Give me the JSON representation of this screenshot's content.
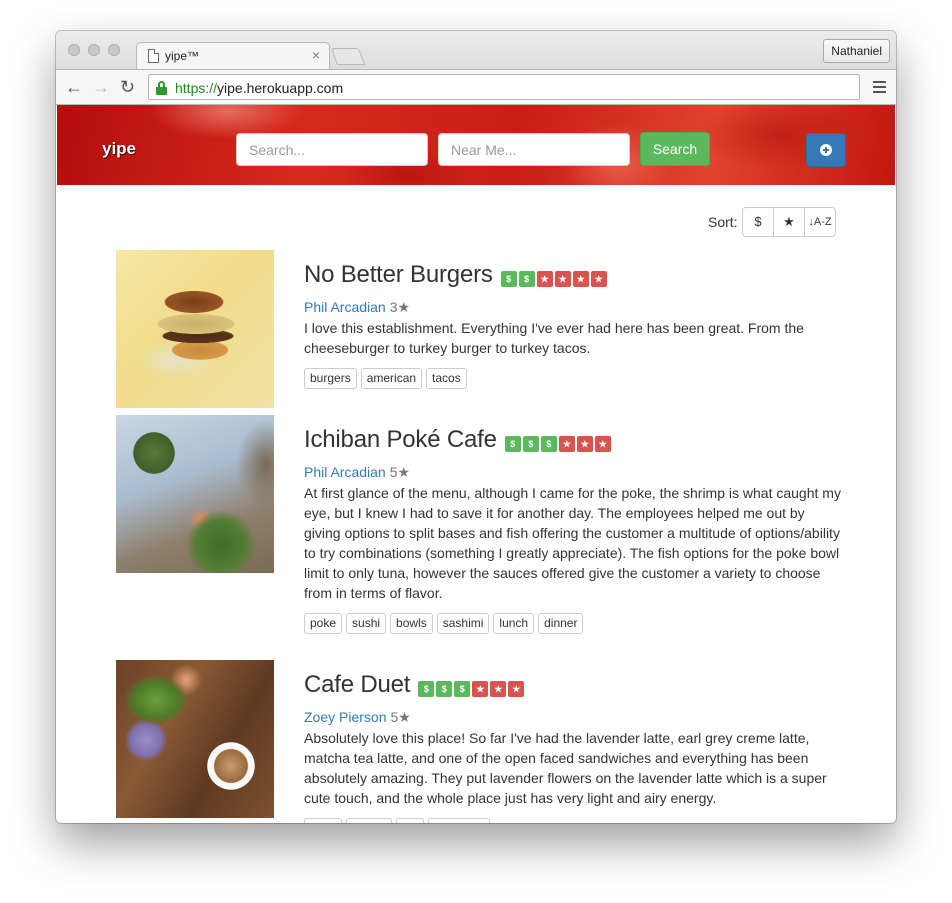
{
  "browser": {
    "tab_title": "yipe™",
    "tab_close": "×",
    "profile": "Nathaniel",
    "url_scheme": "https://",
    "url_host": "yipe.herokuapp.com"
  },
  "header": {
    "brand": "yipe",
    "search_placeholder": "Search...",
    "near_placeholder": "Near Me...",
    "search_button": "Search"
  },
  "sort": {
    "label": "Sort:",
    "options": [
      "$",
      "★",
      "↓A-Z"
    ]
  },
  "reviews": [
    {
      "name": "No Better Burgers",
      "price_level": 2,
      "stars": 4,
      "author": "Phil Arcadian",
      "author_rating": "3★",
      "text": "I love this establishment. Everything I've ever had here has been great. From the cheeseburger to turkey burger to turkey tacos.",
      "tags": [
        "burgers",
        "american",
        "tacos"
      ]
    },
    {
      "name": "Ichiban Poké Cafe",
      "price_level": 3,
      "stars": 3,
      "author": "Phil Arcadian",
      "author_rating": "5★",
      "text": "At first glance of the menu, although I came for the poke, the shrimp is what caught my eye, but I knew I had to save it for another day. The employees helped me out by giving options to split bases and fish offering the customer a multitude of options/ability to try combinations (something I greatly appreciate). The fish options for the poke bowl limit to only tuna, however the sauces offered give the customer a variety to choose from in terms of flavor.",
      "tags": [
        "poke",
        "sushi",
        "bowls",
        "sashimi",
        "lunch",
        "dinner"
      ]
    },
    {
      "name": "Cafe Duet",
      "price_level": 3,
      "stars": 3,
      "author": "Zoey Pierson",
      "author_rating": "5★",
      "text": "Absolutely love this place! So far I've had the lavender latte, earl grey creme latte, matcha tea latte, and one of the open faced sandwiches and everything has been absolutely amazing. They put lavender flowers on the lavender latte which is a super cute touch, and the whole place just has very light and airy energy.",
      "tags": [
        "",
        "",
        "",
        ""
      ]
    }
  ],
  "badge_glyphs": {
    "price": "$",
    "star": "★"
  }
}
